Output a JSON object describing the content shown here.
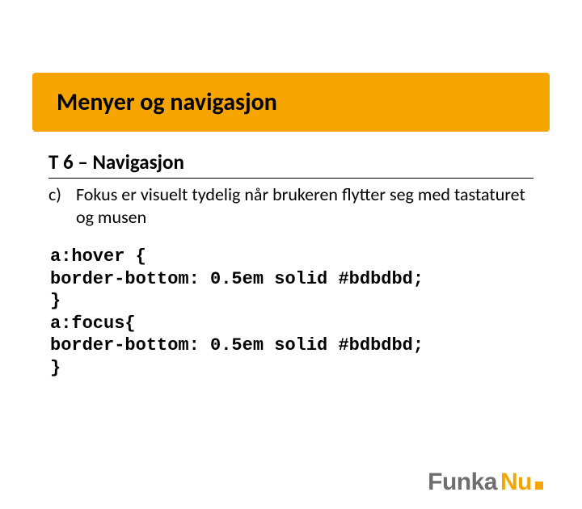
{
  "title": "Menyer og navigasjon",
  "subhead": "T 6 – Navigasjon",
  "bullet": {
    "marker": "c)",
    "text": "Fokus er visuelt tydelig når brukeren flytter seg med tastaturet og musen"
  },
  "code": "a:hover {\nborder-bottom: 0.5em solid #bdbdbd;\n}\na:focus{\nborder-bottom: 0.5em solid #bdbdbd;\n}",
  "logo": {
    "part1": "Funka",
    "part2": "Nu"
  }
}
